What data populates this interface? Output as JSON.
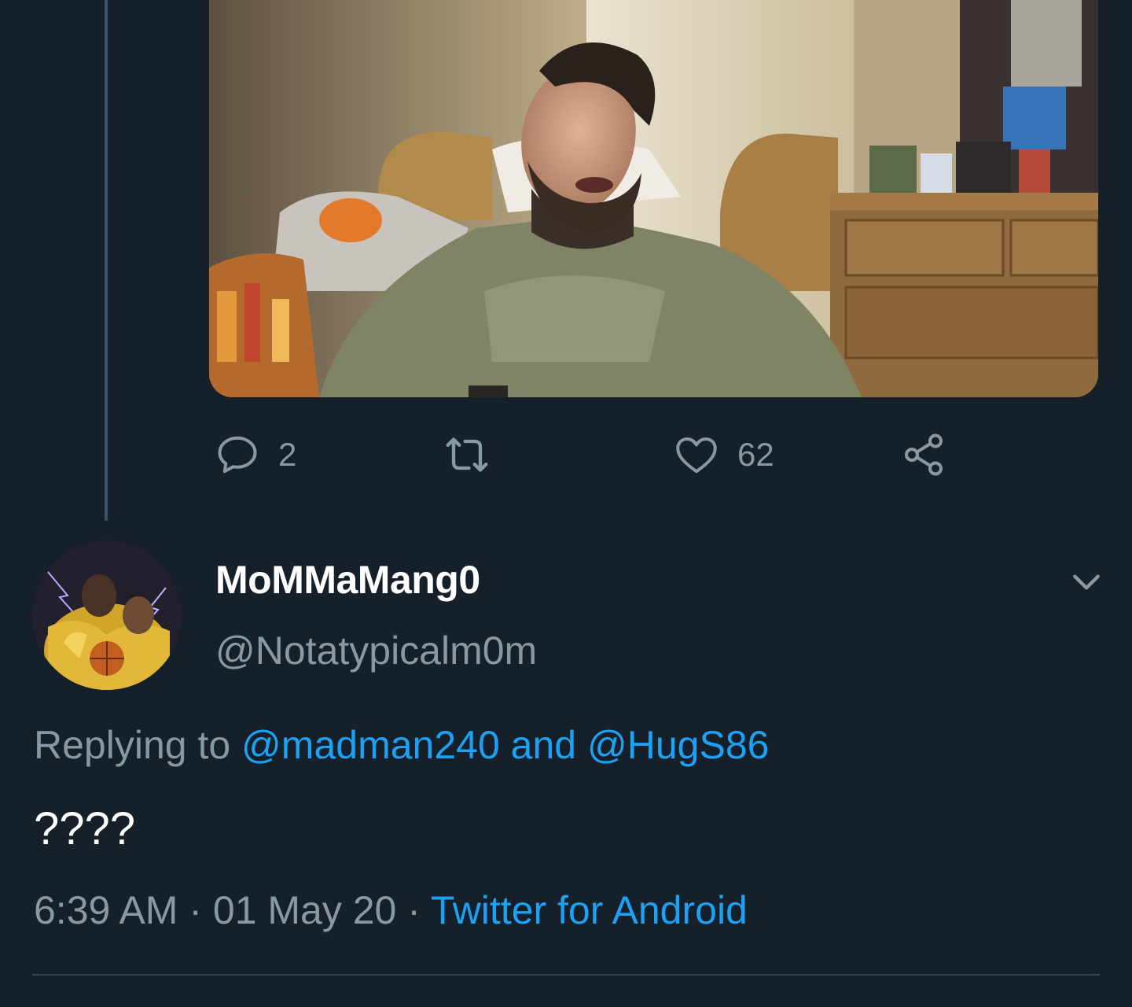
{
  "theme": {
    "background": "#15202b",
    "muted_text": "#8899a6",
    "link_color": "#1da1f2",
    "divider": "#38444d",
    "thread_line": "#3d5466"
  },
  "previous_tweet": {
    "media": {
      "type": "video-thumbnail",
      "description_icon": "video-frame"
    },
    "actions": {
      "reply_count": "2",
      "retweet_count": "",
      "like_count": "62",
      "icons": [
        "reply-icon",
        "retweet-icon",
        "like-icon",
        "share-icon"
      ]
    }
  },
  "tweet": {
    "display_name": "MoMMaMang0",
    "handle": "@Notatypicalm0m",
    "replying_prefix": "Replying to ",
    "reply_to_1": "@madman240",
    "reply_to_joiner": " and ",
    "reply_to_2": "@HugS86",
    "text": "????",
    "time": "6:39 AM",
    "separator": " · ",
    "date": "01 May 20",
    "source": "Twitter for Android"
  }
}
